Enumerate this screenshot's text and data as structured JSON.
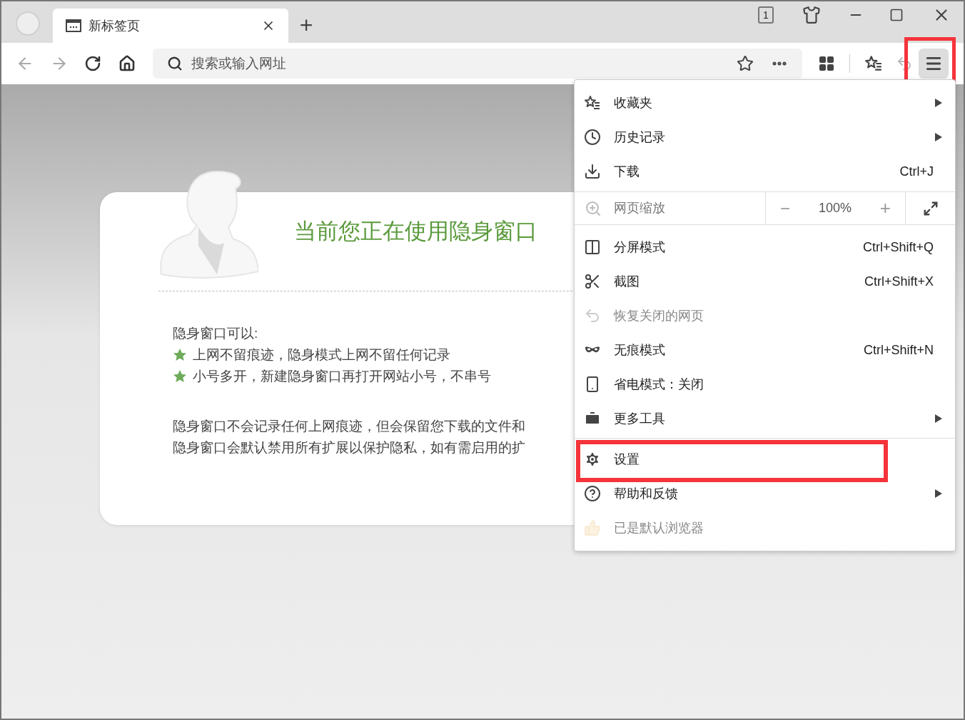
{
  "tab_bar": {
    "tabs": [
      {
        "title": "新标签页",
        "selected": true
      }
    ],
    "new_tab": "+",
    "tab_count": "1"
  },
  "toolbar": {
    "back_disabled": true,
    "forward_disabled": true,
    "undo_disabled": true,
    "address": {
      "placeholder": "搜索或输入网址"
    },
    "menu_button": {
      "highlighted": true
    }
  },
  "incognito_page": {
    "title": "当前您正在使用隐身窗口",
    "intro": "隐身窗口可以:",
    "features": [
      "上网不留痕迹，隐身模式上网不留任何记录",
      "小号多开，新建隐身窗口再打开网站小号，不串号"
    ],
    "notes": [
      "隐身窗口不会记录任何上网痕迹，但会保留您下载的文件和",
      "隐身窗口会默认禁用所有扩展以保护隐私，如有需启用的扩"
    ]
  },
  "menu": {
    "groups": [
      [
        {
          "label": "收藏夹",
          "submenu": true,
          "disabled": false,
          "highlighted": false
        },
        {
          "label": "历史记录",
          "submenu": true,
          "disabled": false,
          "highlighted": false
        },
        {
          "label": "下载",
          "shortcut": "Ctrl+J",
          "submenu": false,
          "disabled": false,
          "highlighted": false
        }
      ],
      [
        {
          "label": "分屏模式",
          "shortcut": "Ctrl+Shift+Q",
          "submenu": false,
          "disabled": false,
          "highlighted": false
        },
        {
          "label": "截图",
          "shortcut": "Ctrl+Shift+X",
          "submenu": false,
          "disabled": false,
          "highlighted": false
        },
        {
          "label": "恢复关闭的网页",
          "submenu": false,
          "disabled": true,
          "highlighted": false
        },
        {
          "label": "无痕模式",
          "shortcut": "Ctrl+Shift+N",
          "submenu": false,
          "disabled": false,
          "highlighted": false
        },
        {
          "label": "省电模式：关闭",
          "submenu": false,
          "disabled": false,
          "highlighted": false
        },
        {
          "label": "更多工具",
          "submenu": true,
          "disabled": false,
          "highlighted": false
        }
      ],
      [
        {
          "label": "设置",
          "submenu": false,
          "disabled": false,
          "highlighted": true
        },
        {
          "label": "帮助和反馈",
          "submenu": true,
          "disabled": false,
          "highlighted": false
        },
        {
          "label": "已是默认浏览器",
          "submenu": false,
          "disabled": true,
          "highlighted": false
        }
      ]
    ],
    "zoom": {
      "label": "网页缩放",
      "decrease": "−",
      "value": "100%",
      "increase": "+"
    }
  }
}
